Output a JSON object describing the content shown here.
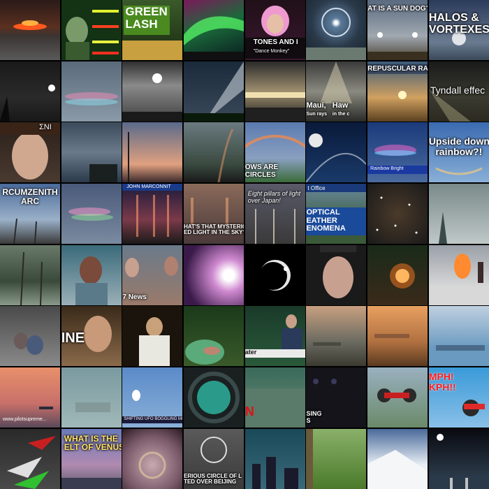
{
  "tiles": [
    {
      "id": "r1c1",
      "caption": ""
    },
    {
      "id": "r1c2",
      "caption": ""
    },
    {
      "id": "r1c3",
      "caption": "GREEN\nLASH"
    },
    {
      "id": "r1c4",
      "caption": ""
    },
    {
      "id": "r1c5",
      "caption": "TONES AND I",
      "subcaption": "\"Dance Monkey\""
    },
    {
      "id": "r1c6",
      "caption": ""
    },
    {
      "id": "r1c7",
      "caption": "AT IS A SUN DOG?"
    },
    {
      "id": "r1c8",
      "caption": "HALOS &\nVORTEXES"
    },
    {
      "id": "r2c1",
      "caption": ""
    },
    {
      "id": "r2c2",
      "caption": ""
    },
    {
      "id": "r2c3",
      "caption": ""
    },
    {
      "id": "r2c4",
      "caption": ""
    },
    {
      "id": "r2c5",
      "caption": ""
    },
    {
      "id": "r2c6",
      "caption": "Maui,   Haw",
      "subcaption": "Sun rays    in the c"
    },
    {
      "id": "r2c7",
      "caption": "REPUSCULAR RAY"
    },
    {
      "id": "r2c8",
      "caption": "Tyndall effec"
    },
    {
      "id": "r3c1",
      "caption": "ΣNI"
    },
    {
      "id": "r3c2",
      "caption": ""
    },
    {
      "id": "r3c3",
      "caption": ""
    },
    {
      "id": "r3c4",
      "caption": ""
    },
    {
      "id": "r3c5",
      "caption": "OWS ARE\nCIRCLES"
    },
    {
      "id": "r3c6",
      "caption": ""
    },
    {
      "id": "r3c7",
      "caption": "Rainbow Bright"
    },
    {
      "id": "r3c8",
      "caption": "Upside down\nrainbow?!"
    },
    {
      "id": "r4c1",
      "caption": "RCUMZENITH\nARC"
    },
    {
      "id": "r4c2",
      "caption": ""
    },
    {
      "id": "r4c3",
      "caption": "JOHN MARCONNIT"
    },
    {
      "id": "r4c4",
      "caption": "HAT'S THAT MYSTERIOUS\nED LIGHT IN THE SKY?"
    },
    {
      "id": "r4c5",
      "caption": "Eight pillars of light\nover Japan!"
    },
    {
      "id": "r4c6",
      "caption": "OPTICAL\nEATHER\nENOMENA",
      "subcaption": "t Office"
    },
    {
      "id": "r4c7",
      "caption": ""
    },
    {
      "id": "r4c8",
      "caption": ""
    },
    {
      "id": "r5c1",
      "caption": ""
    },
    {
      "id": "r5c2",
      "caption": ""
    },
    {
      "id": "r5c3",
      "caption": "7 News"
    },
    {
      "id": "r5c4",
      "caption": ""
    },
    {
      "id": "r5c5",
      "caption": ""
    },
    {
      "id": "r5c6",
      "caption": ""
    },
    {
      "id": "r5c7",
      "caption": ""
    },
    {
      "id": "r5c8",
      "caption": ""
    },
    {
      "id": "r6c1",
      "caption": ""
    },
    {
      "id": "r6c2",
      "caption": "INE"
    },
    {
      "id": "r6c3",
      "caption": ""
    },
    {
      "id": "r6c4",
      "caption": ""
    },
    {
      "id": "r6c5",
      "caption": "ater"
    },
    {
      "id": "r6c6",
      "caption": ""
    },
    {
      "id": "r6c7",
      "caption": ""
    },
    {
      "id": "r6c8",
      "caption": ""
    },
    {
      "id": "r7c1",
      "caption": "www.pilotsupreme..."
    },
    {
      "id": "r7c2",
      "caption": ""
    },
    {
      "id": "r7c3",
      "caption": "SHIFTING UFO BOGGLING MINDS"
    },
    {
      "id": "r7c4",
      "caption": ""
    },
    {
      "id": "r7c5",
      "caption": "N"
    },
    {
      "id": "r7c6",
      "caption": "SING\nS"
    },
    {
      "id": "r7c7",
      "caption": ""
    },
    {
      "id": "r7c8",
      "caption": "MPH!\nKPH!!"
    },
    {
      "id": "r8c1",
      "caption": ""
    },
    {
      "id": "r8c2",
      "caption": "WHAT IS THE\nELT OF VENUS"
    },
    {
      "id": "r8c3",
      "caption": ""
    },
    {
      "id": "r8c4",
      "caption": "ERIOUS CIRCLE OF L\nTED OVER BEIJING"
    },
    {
      "id": "r8c5",
      "caption": ""
    },
    {
      "id": "r8c6",
      "caption": ""
    },
    {
      "id": "r8c7",
      "caption": ""
    },
    {
      "id": "r8c8",
      "caption": ""
    }
  ]
}
